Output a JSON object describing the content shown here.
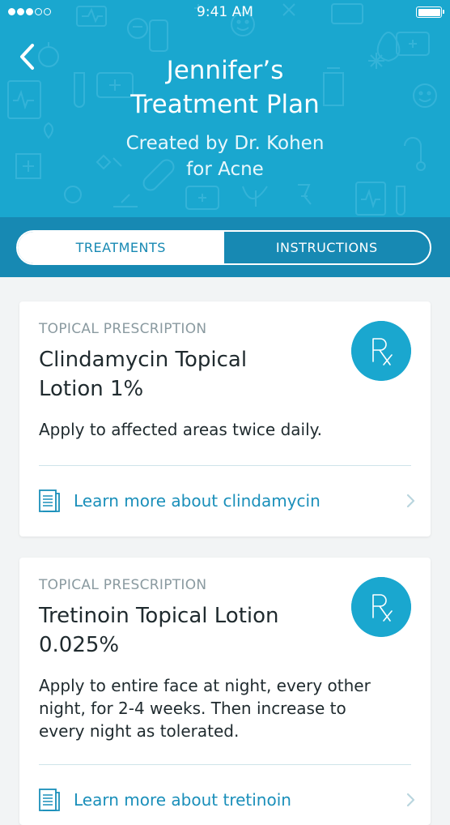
{
  "colors": {
    "header_bg": "#1aa7cf",
    "tabbar_bg": "#1789b3",
    "accent": "#1a8fba",
    "background": "#f2f4f5"
  },
  "status_bar": {
    "time": "9:41 AM",
    "signal_bars_filled": 3,
    "signal_bars_total": 5
  },
  "header": {
    "back_icon": "chevron-left-icon",
    "title_line1": "Jennifer’s",
    "title_line2": "Treatment Plan",
    "subtitle_line1": "Created by Dr. Kohen",
    "subtitle_line2": "for Acne"
  },
  "tabs": [
    {
      "label": "TREATMENTS",
      "active": true
    },
    {
      "label": "INSTRUCTIONS",
      "active": false
    }
  ],
  "treatments": [
    {
      "category": "TOPICAL PRESCRIPTION",
      "name_line1": "Clindamycin Topical",
      "name_line2": "Lotion 1%",
      "icon": "rx-icon",
      "icon_text": "Rx",
      "directions": "Apply to affected areas twice daily.",
      "link": "Learn more about clindamycin"
    },
    {
      "category": "TOPICAL PRESCRIPTION",
      "name_line1": "Tretinoin Topical Lotion",
      "name_line2": "0.025%",
      "icon": "rx-icon",
      "icon_text": "Rx",
      "directions_line1": "Apply to entire face at night, every other",
      "directions_line2": "night, for 2-4 weeks. Then increase to",
      "directions_line3": "every night as tolerated.",
      "link": "Learn more about tretinoin"
    }
  ]
}
